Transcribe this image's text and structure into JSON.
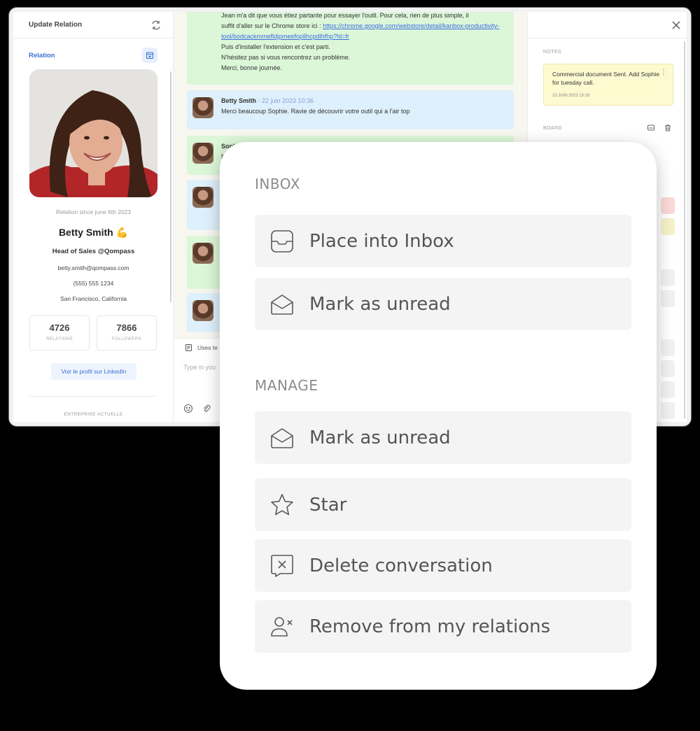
{
  "window": {
    "left": {
      "title": "Update Relation",
      "relation_label": "Relation",
      "since": "Relation since june 6th 2023",
      "name": "Betty Smith 💪",
      "role": "Head of Sales @Qompass",
      "email": "betty.smith@qompass.com",
      "phone": "(555) 555 1234",
      "city": "San Francisco, California",
      "stats": [
        {
          "value": "4726",
          "label": "RELATIONS"
        },
        {
          "value": "7866",
          "label": "FOLLOWERS"
        }
      ],
      "linkedin_label": "Voir le profil sur LinkedIn",
      "company_label": "ENTREPRISE ACTUELLE"
    },
    "chat": {
      "messages": [
        {
          "lines": [
            "Jean m'a dit que vous étiez partante pour essayer l'outil. Pour cela, rien de plus simple, il",
            "suffit d'aller sur le Chrome store ici : "
          ],
          "link": "https://chrome.google.com/webstore/detail/kanbox-productivity-tool/bodcackmmefldjpmeefopllhcpdlhfhp?hl=fr",
          "after_lines": [
            "Puis d'installer l'extension et c'est parti.",
            "N'hésitez pas si vous rencontrez un problème.",
            "Merci, bonne journée."
          ]
        },
        {
          "author": "Betty Smith",
          "date": " - 22 juin 2023 10:36",
          "text": "Merci beaucoup Sophie. Ravie de découvrir votre outil qui a l'air top"
        },
        {
          "author": "Sophi",
          "text": "M"
        }
      ],
      "composer_hint": "Uses te",
      "input_placeholder": "Type in you"
    },
    "right": {
      "notes_label": "NOTES",
      "note_text": "Commercial document Sent. Add Sophie for tuesday call.",
      "note_date": "23 JUIN 2023 15:16",
      "board_label": "BOARD"
    }
  },
  "menu": {
    "inbox_title": "INBOX",
    "manage_title": "MANAGE",
    "inbox_items": [
      {
        "label": "Place into Inbox",
        "icon": "inbox-tray-icon"
      },
      {
        "label": "Mark as unread",
        "icon": "envelope-open-icon"
      }
    ],
    "manage_items": [
      {
        "label": "Mark as unread",
        "icon": "envelope-open-icon"
      },
      {
        "label": "Star",
        "icon": "star-icon"
      },
      {
        "label": "Delete conversation",
        "icon": "delete-chat-icon"
      },
      {
        "label": "Remove from my relations",
        "icon": "remove-user-icon"
      }
    ]
  },
  "colors": {
    "accent": "#3b6fd4",
    "green_bubble": "#dcf6d8",
    "blue_bubble": "#def0fb",
    "note": "#fdfad0",
    "menu_item_bg": "#f4f4f4"
  }
}
